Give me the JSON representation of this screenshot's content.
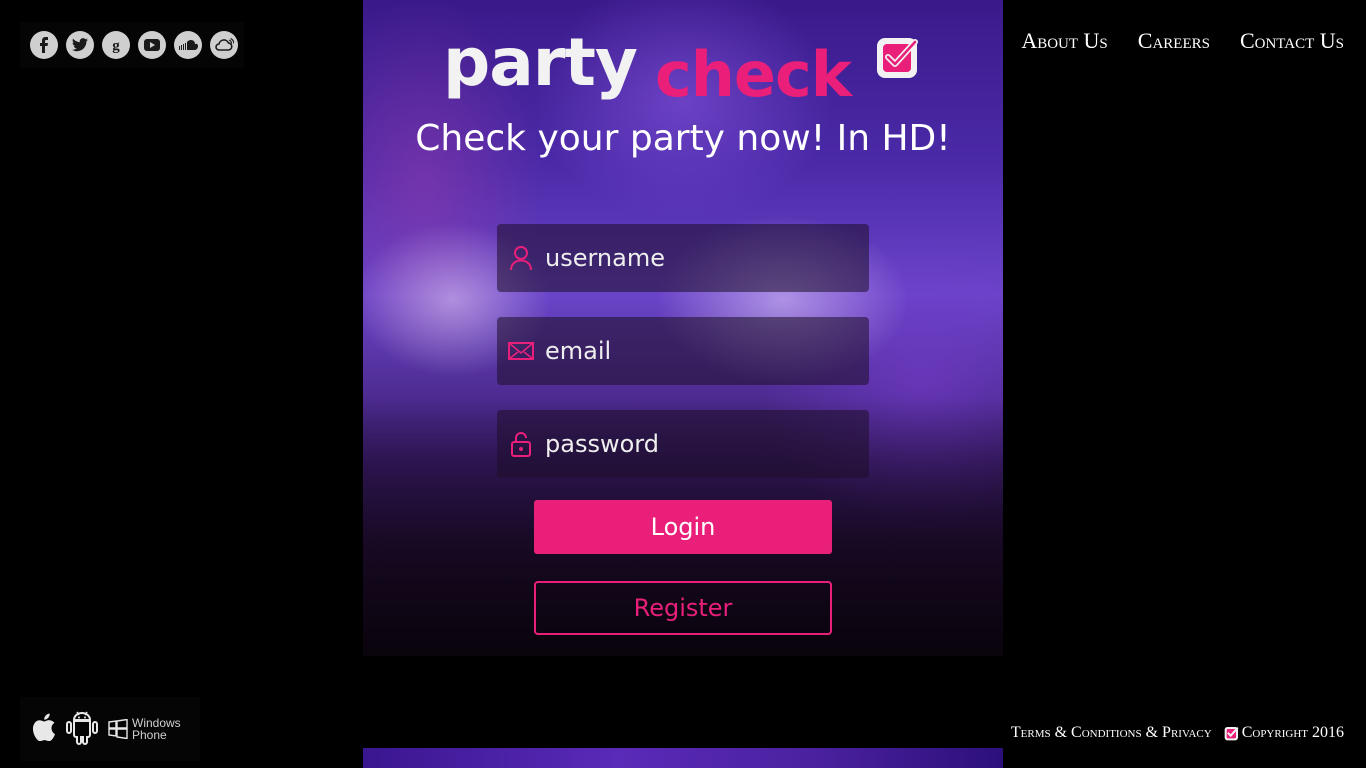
{
  "social": {
    "icons": [
      "facebook-icon",
      "twitter-icon",
      "google-plus-icon",
      "youtube-icon",
      "soundcloud-icon",
      "cloud-signal-icon"
    ]
  },
  "brand": {
    "logo_part1": "party",
    "logo_part2": "check",
    "tagline": "Check your party now! In HD!",
    "accent_color": "#e91f7a"
  },
  "nav": {
    "items": [
      "About Us",
      "Careers",
      "Contact Us"
    ]
  },
  "form": {
    "username_placeholder": "username",
    "email_placeholder": "email",
    "password_placeholder": "password",
    "login_label": "Login",
    "register_label": "Register"
  },
  "apps": {
    "icons": [
      "apple-icon",
      "android-icon",
      "windows-phone-icon"
    ],
    "windows_line1": "Windows",
    "windows_line2": "Phone"
  },
  "footer": {
    "terms": "Terms & Conditions & Privacy",
    "copyright": "Copyright 2016"
  }
}
